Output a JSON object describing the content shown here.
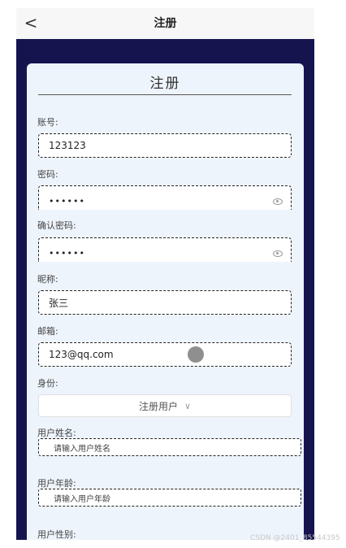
{
  "nav": {
    "back": "<",
    "title": "注册"
  },
  "form": {
    "title": "注册",
    "account": {
      "label": "账号:",
      "value": "123123"
    },
    "password": {
      "label": "密码:",
      "value": "••••••"
    },
    "confirm": {
      "label": "确认密码:",
      "value": "••••••"
    },
    "nickname": {
      "label": "昵称:",
      "value": "张三"
    },
    "email": {
      "label": "邮箱:",
      "value": "123@qq.com"
    },
    "identity": {
      "label": "身份:",
      "value": "注册用户",
      "chevron": "∨"
    },
    "realname": {
      "label": "用户姓名:",
      "placeholder": "请输入用户姓名"
    },
    "age": {
      "label": "用户年龄:",
      "placeholder": "请输入用户年龄"
    },
    "gender": {
      "label": "用户性别:"
    }
  },
  "watermark": "CSDN @2401_85544395"
}
